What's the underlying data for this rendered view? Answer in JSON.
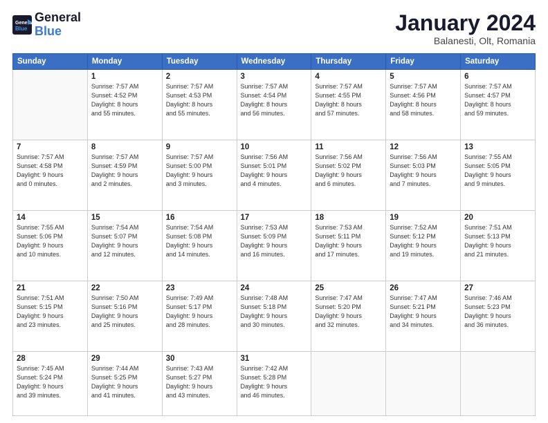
{
  "header": {
    "logo_line1": "General",
    "logo_line2": "Blue",
    "month": "January 2024",
    "location": "Balanesti, Olt, Romania"
  },
  "weekdays": [
    "Sunday",
    "Monday",
    "Tuesday",
    "Wednesday",
    "Thursday",
    "Friday",
    "Saturday"
  ],
  "weeks": [
    [
      {
        "day": "",
        "info": ""
      },
      {
        "day": "1",
        "info": "Sunrise: 7:57 AM\nSunset: 4:52 PM\nDaylight: 8 hours\nand 55 minutes."
      },
      {
        "day": "2",
        "info": "Sunrise: 7:57 AM\nSunset: 4:53 PM\nDaylight: 8 hours\nand 55 minutes."
      },
      {
        "day": "3",
        "info": "Sunrise: 7:57 AM\nSunset: 4:54 PM\nDaylight: 8 hours\nand 56 minutes."
      },
      {
        "day": "4",
        "info": "Sunrise: 7:57 AM\nSunset: 4:55 PM\nDaylight: 8 hours\nand 57 minutes."
      },
      {
        "day": "5",
        "info": "Sunrise: 7:57 AM\nSunset: 4:56 PM\nDaylight: 8 hours\nand 58 minutes."
      },
      {
        "day": "6",
        "info": "Sunrise: 7:57 AM\nSunset: 4:57 PM\nDaylight: 8 hours\nand 59 minutes."
      }
    ],
    [
      {
        "day": "7",
        "info": "Sunrise: 7:57 AM\nSunset: 4:58 PM\nDaylight: 9 hours\nand 0 minutes."
      },
      {
        "day": "8",
        "info": "Sunrise: 7:57 AM\nSunset: 4:59 PM\nDaylight: 9 hours\nand 2 minutes."
      },
      {
        "day": "9",
        "info": "Sunrise: 7:57 AM\nSunset: 5:00 PM\nDaylight: 9 hours\nand 3 minutes."
      },
      {
        "day": "10",
        "info": "Sunrise: 7:56 AM\nSunset: 5:01 PM\nDaylight: 9 hours\nand 4 minutes."
      },
      {
        "day": "11",
        "info": "Sunrise: 7:56 AM\nSunset: 5:02 PM\nDaylight: 9 hours\nand 6 minutes."
      },
      {
        "day": "12",
        "info": "Sunrise: 7:56 AM\nSunset: 5:03 PM\nDaylight: 9 hours\nand 7 minutes."
      },
      {
        "day": "13",
        "info": "Sunrise: 7:55 AM\nSunset: 5:05 PM\nDaylight: 9 hours\nand 9 minutes."
      }
    ],
    [
      {
        "day": "14",
        "info": "Sunrise: 7:55 AM\nSunset: 5:06 PM\nDaylight: 9 hours\nand 10 minutes."
      },
      {
        "day": "15",
        "info": "Sunrise: 7:54 AM\nSunset: 5:07 PM\nDaylight: 9 hours\nand 12 minutes."
      },
      {
        "day": "16",
        "info": "Sunrise: 7:54 AM\nSunset: 5:08 PM\nDaylight: 9 hours\nand 14 minutes."
      },
      {
        "day": "17",
        "info": "Sunrise: 7:53 AM\nSunset: 5:09 PM\nDaylight: 9 hours\nand 16 minutes."
      },
      {
        "day": "18",
        "info": "Sunrise: 7:53 AM\nSunset: 5:11 PM\nDaylight: 9 hours\nand 17 minutes."
      },
      {
        "day": "19",
        "info": "Sunrise: 7:52 AM\nSunset: 5:12 PM\nDaylight: 9 hours\nand 19 minutes."
      },
      {
        "day": "20",
        "info": "Sunrise: 7:51 AM\nSunset: 5:13 PM\nDaylight: 9 hours\nand 21 minutes."
      }
    ],
    [
      {
        "day": "21",
        "info": "Sunrise: 7:51 AM\nSunset: 5:15 PM\nDaylight: 9 hours\nand 23 minutes."
      },
      {
        "day": "22",
        "info": "Sunrise: 7:50 AM\nSunset: 5:16 PM\nDaylight: 9 hours\nand 25 minutes."
      },
      {
        "day": "23",
        "info": "Sunrise: 7:49 AM\nSunset: 5:17 PM\nDaylight: 9 hours\nand 28 minutes."
      },
      {
        "day": "24",
        "info": "Sunrise: 7:48 AM\nSunset: 5:18 PM\nDaylight: 9 hours\nand 30 minutes."
      },
      {
        "day": "25",
        "info": "Sunrise: 7:47 AM\nSunset: 5:20 PM\nDaylight: 9 hours\nand 32 minutes."
      },
      {
        "day": "26",
        "info": "Sunrise: 7:47 AM\nSunset: 5:21 PM\nDaylight: 9 hours\nand 34 minutes."
      },
      {
        "day": "27",
        "info": "Sunrise: 7:46 AM\nSunset: 5:23 PM\nDaylight: 9 hours\nand 36 minutes."
      }
    ],
    [
      {
        "day": "28",
        "info": "Sunrise: 7:45 AM\nSunset: 5:24 PM\nDaylight: 9 hours\nand 39 minutes."
      },
      {
        "day": "29",
        "info": "Sunrise: 7:44 AM\nSunset: 5:25 PM\nDaylight: 9 hours\nand 41 minutes."
      },
      {
        "day": "30",
        "info": "Sunrise: 7:43 AM\nSunset: 5:27 PM\nDaylight: 9 hours\nand 43 minutes."
      },
      {
        "day": "31",
        "info": "Sunrise: 7:42 AM\nSunset: 5:28 PM\nDaylight: 9 hours\nand 46 minutes."
      },
      {
        "day": "",
        "info": ""
      },
      {
        "day": "",
        "info": ""
      },
      {
        "day": "",
        "info": ""
      }
    ]
  ]
}
